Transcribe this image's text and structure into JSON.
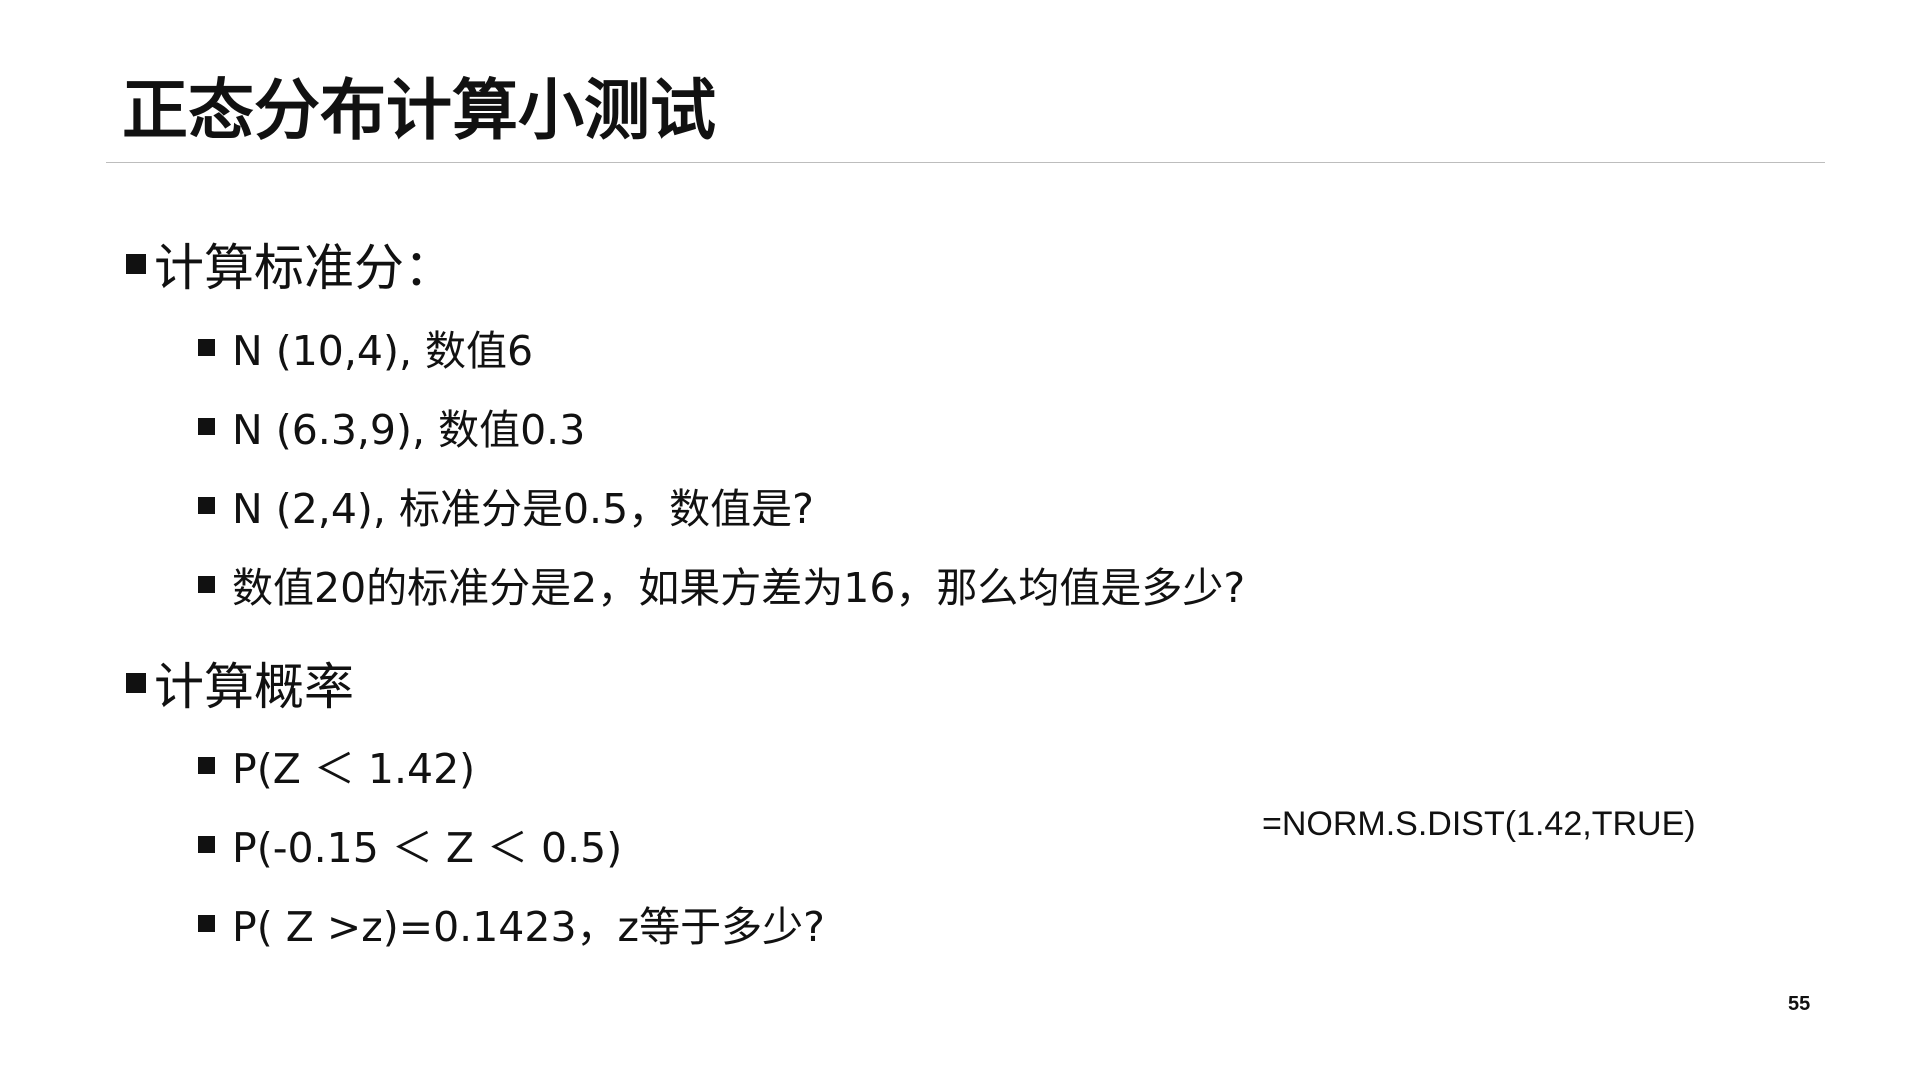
{
  "slide": {
    "title": "正态分布计算小测试",
    "sections": [
      {
        "heading": "计算标准分：",
        "items": [
          "N (10,4), 数值6",
          "N (6.3,9), 数值0.3",
          "N (2,4), 标准分是0.5，数值是?",
          "数值20的标准分是2，如果方差为16，那么均值是多少?"
        ]
      },
      {
        "heading": "计算概率",
        "items": [
          "P(Z ＜ 1.42)",
          "P(-0.15 ＜ Z ＜ 0.5)",
          "P( Z >z)=0.1423，z等于多少?"
        ]
      }
    ],
    "formula_note": "=NORM.S.DIST(1.42,TRUE)",
    "page_number": "55"
  }
}
